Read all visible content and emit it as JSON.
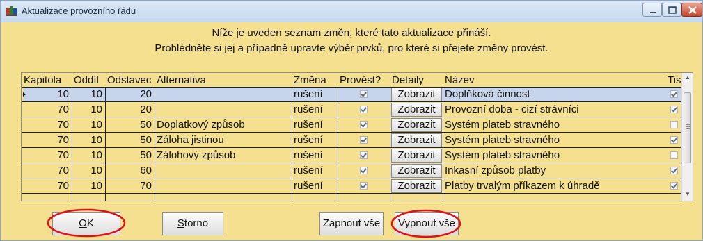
{
  "window": {
    "title": "Aktualizace provozního řádu"
  },
  "intro": {
    "line1": "Níže je uveden seznam změn, které tato aktualizace přináší.",
    "line2": "Prohlédněte si jej a případně upravte výběr prvků, pro které si přejete změny provést."
  },
  "table": {
    "headers": {
      "kapitola": "Kapitola",
      "oddil": "Oddíl",
      "odstavec": "Odstavec",
      "alternativa": "Alternativa",
      "zmena": "Změna",
      "provest": "Provést?",
      "detaily": "Detaily",
      "nazev": "Název",
      "tisk": "Tisk?"
    },
    "rows": [
      {
        "kapitola": "10",
        "oddil": "10",
        "odstavec": "20",
        "alternativa": "",
        "zmena": "rušení",
        "provest": true,
        "detaily": "Zobrazit",
        "nazev": "Doplňková činnost",
        "tisk": true
      },
      {
        "kapitola": "70",
        "oddil": "10",
        "odstavec": "20",
        "alternativa": "",
        "zmena": "rušení",
        "provest": true,
        "detaily": "Zobrazit",
        "nazev": "Provozní doba - cizí strávníci",
        "tisk": true
      },
      {
        "kapitola": "70",
        "oddil": "10",
        "odstavec": "50",
        "alternativa": "Doplatkový způsob",
        "zmena": "rušení",
        "provest": true,
        "detaily": "Zobrazit",
        "nazev": "Systém plateb stravného",
        "tisk": false
      },
      {
        "kapitola": "70",
        "oddil": "10",
        "odstavec": "50",
        "alternativa": "Záloha jistinou",
        "zmena": "rušení",
        "provest": true,
        "detaily": "Zobrazit",
        "nazev": "Systém plateb stravného",
        "tisk": true
      },
      {
        "kapitola": "70",
        "oddil": "10",
        "odstavec": "50",
        "alternativa": "Zálohový způsob",
        "zmena": "rušení",
        "provest": true,
        "detaily": "Zobrazit",
        "nazev": "Systém plateb stravného",
        "tisk": false
      },
      {
        "kapitola": "70",
        "oddil": "10",
        "odstavec": "60",
        "alternativa": "",
        "zmena": "rušení",
        "provest": true,
        "detaily": "Zobrazit",
        "nazev": "Inkasní způsob platby",
        "tisk": true
      },
      {
        "kapitola": "70",
        "oddil": "10",
        "odstavec": "70",
        "alternativa": "",
        "zmena": "rušení",
        "provest": true,
        "detaily": "Zobrazit",
        "nazev": "Platby trvalým příkazem k úhradě",
        "tisk": true
      }
    ]
  },
  "buttons": {
    "ok": {
      "mnemonic": "O",
      "rest": "K"
    },
    "storno": {
      "mnemonic": "S",
      "rest": "torno"
    },
    "zapnout": "Zapnout vše",
    "vypnout": "Vypnout vše"
  },
  "colors": {
    "dialog_background": "#f4e08f",
    "highlight_red": "#e0101a",
    "selected_row": "#c7d5ec"
  },
  "icons": [
    "app-icon",
    "minimize-icon",
    "maximize-icon",
    "close-icon",
    "row-indicator-icon",
    "scroll-up-icon",
    "scroll-down-icon"
  ]
}
